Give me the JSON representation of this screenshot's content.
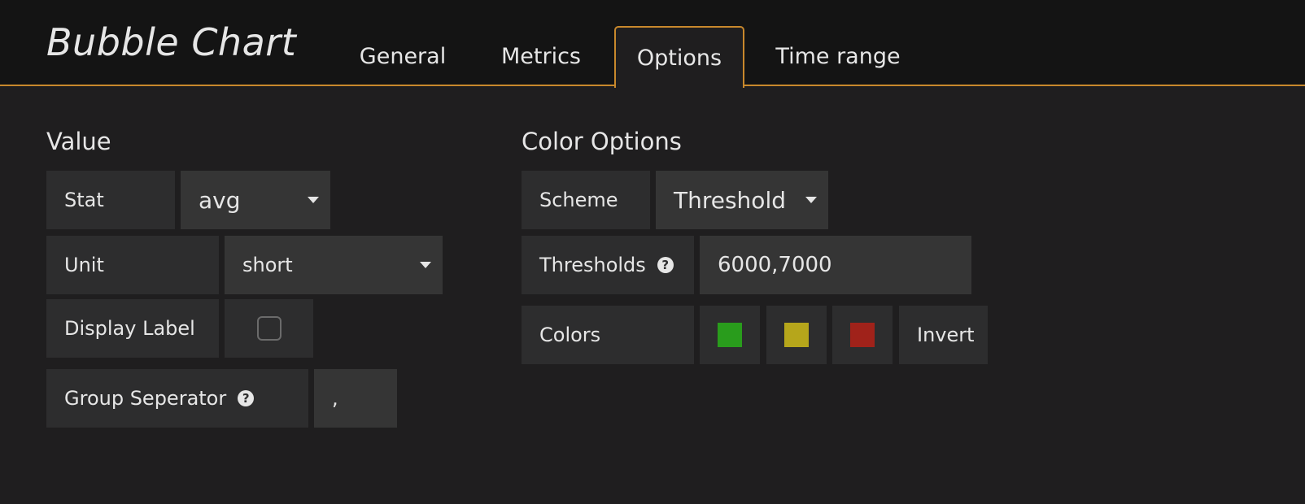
{
  "header": {
    "title": "Bubble Chart",
    "tabs": [
      {
        "label": "General",
        "active": false
      },
      {
        "label": "Metrics",
        "active": false
      },
      {
        "label": "Options",
        "active": true
      },
      {
        "label": "Time range",
        "active": false
      }
    ],
    "accent_color": "#c8882c"
  },
  "value_section": {
    "title": "Value",
    "stat": {
      "label": "Stat",
      "value": "avg"
    },
    "unit": {
      "label": "Unit",
      "value": "short"
    },
    "display_label": {
      "label": "Display Label",
      "checked": false
    },
    "group_separator": {
      "label": "Group Seperator",
      "help_icon": "question-circle-icon",
      "value": ","
    }
  },
  "color_section": {
    "title": "Color Options",
    "scheme": {
      "label": "Scheme",
      "value": "Threshold"
    },
    "thresholds": {
      "label": "Thresholds",
      "help_icon": "question-circle-icon",
      "value": "6000,7000"
    },
    "colors": {
      "label": "Colors",
      "swatches": [
        "#299c1c",
        "#b6a61b",
        "#a0221a"
      ],
      "invert_label": "Invert"
    }
  }
}
